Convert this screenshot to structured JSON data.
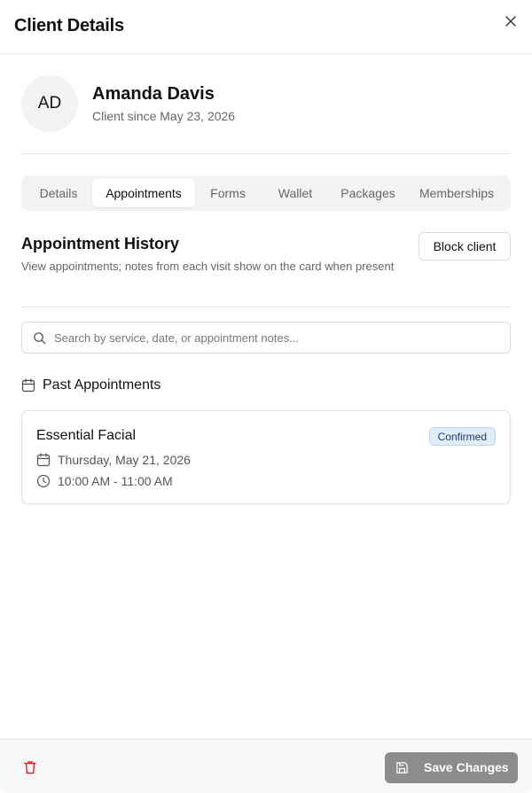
{
  "header": {
    "title": "Client Details"
  },
  "client": {
    "initials": "AD",
    "name": "Amanda Davis",
    "since": "Client since May 23, 2026"
  },
  "tabs": [
    {
      "label": "Details"
    },
    {
      "label": "Appointments"
    },
    {
      "label": "Forms"
    },
    {
      "label": "Wallet"
    },
    {
      "label": "Packages"
    },
    {
      "label": "Memberships"
    }
  ],
  "active_tab": "Appointments",
  "section": {
    "title": "Appointment History",
    "description": "View appointments; notes from each visit show on the card when present",
    "block_label": "Block client"
  },
  "search": {
    "placeholder": "Search by service, date, or appointment notes...",
    "value": ""
  },
  "past": {
    "label": "Past Appointments",
    "appointments": [
      {
        "service": "Essential Facial",
        "status": "Confirmed",
        "date": "Thursday, May 21, 2026",
        "time": "10:00 AM - 11:00 AM"
      }
    ]
  },
  "footer": {
    "save_label": "Save Changes"
  },
  "colors": {
    "status_badge_bg": "#e2edfb",
    "status_badge_text": "#1e3a6a",
    "delete": "#e02424",
    "save_disabled": "#8c8c8c"
  },
  "icons": [
    "close-icon",
    "search-icon",
    "calendar-icon",
    "clock-icon",
    "trash-icon",
    "save-icon"
  ]
}
